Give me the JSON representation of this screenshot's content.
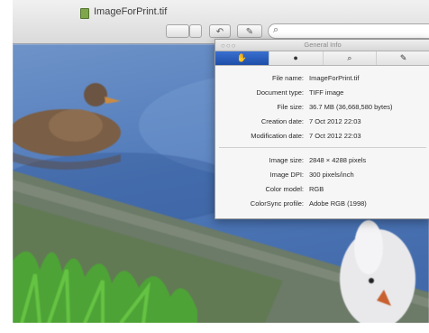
{
  "window": {
    "title": "ImageForPrint.tif",
    "icons": {
      "doc": "tiff-document-icon",
      "rotate": "rotate-icon",
      "markup": "markup-pen-icon",
      "search": "search-icon"
    },
    "toolbar": {
      "rotate_label": "↶",
      "markup_label": "✎",
      "search_label": "⌕"
    }
  },
  "panel": {
    "title": "General Info",
    "tabs": [
      {
        "label": "✋",
        "icon": "hand-icon",
        "active": true
      },
      {
        "label": "●",
        "icon": "info-icon",
        "active": false
      },
      {
        "label": "⌕",
        "icon": "magnifier-icon",
        "active": false
      },
      {
        "label": "✎",
        "icon": "pen-icon",
        "active": false
      }
    ],
    "rows": [
      {
        "label": "File name:",
        "value": "ImageForPrint.tif"
      },
      {
        "label": "Document type:",
        "value": "TIFF image"
      },
      {
        "label": "File size:",
        "value": "36.7 MB (36,668,580 bytes)"
      },
      {
        "label": "Creation date:",
        "value": "7 Oct 2012 22:03"
      },
      {
        "label": "Modification date:",
        "value": "7 Oct 2012 22:03"
      },
      {
        "label": "Image size:",
        "value": "2848 × 4288 pixels"
      },
      {
        "label": "Image DPI:",
        "value": "300 pixels/inch"
      },
      {
        "label": "Color model:",
        "value": "RGB"
      },
      {
        "label": "ColorSync profile:",
        "value": "Adobe RGB (1998)"
      }
    ]
  },
  "colors": {
    "water": "#4f79b9",
    "grass": "#4ea336",
    "accent_tab": "#1d4ea8"
  }
}
